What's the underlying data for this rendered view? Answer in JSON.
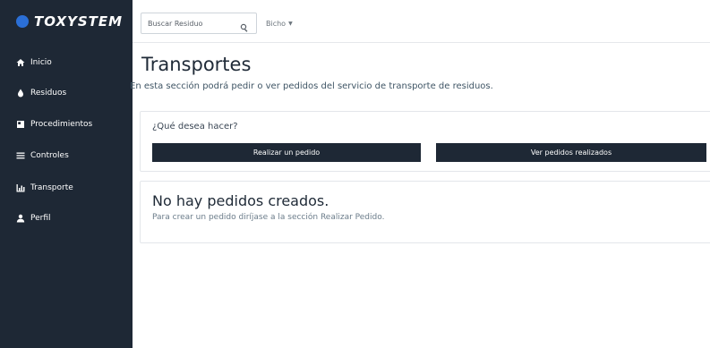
{
  "brand": {
    "name": "TOXYSTEM"
  },
  "sidebar": {
    "items": [
      {
        "label": "Inicio",
        "icon": "home-icon"
      },
      {
        "label": "Residuos",
        "icon": "drop-icon"
      },
      {
        "label": "Procedimientos",
        "icon": "document-icon"
      },
      {
        "label": "Controles",
        "icon": "list-icon"
      },
      {
        "label": "Transporte",
        "icon": "chart-icon"
      },
      {
        "label": "Perfil",
        "icon": "user-icon"
      }
    ]
  },
  "topbar": {
    "search_placeholder": "Buscar Residuo",
    "user_label": "Bicho"
  },
  "main": {
    "title": "Transportes",
    "subtitle": "En esta sección podrá pedir o ver pedidos del servicio de transporte de residuos.",
    "actions": {
      "title": "¿Qué desea hacer?",
      "order_button": "Realizar un pedido",
      "view_button": "Ver pedidos realizados"
    },
    "empty": {
      "title": "No hay pedidos creados.",
      "text": "Para crear un pedido diríjase a la sección Realizar Pedido."
    }
  },
  "colors": {
    "sidebar_bg": "#1e2835",
    "button_bg": "#1e2835",
    "logo_accent": "#2b6fd6"
  }
}
